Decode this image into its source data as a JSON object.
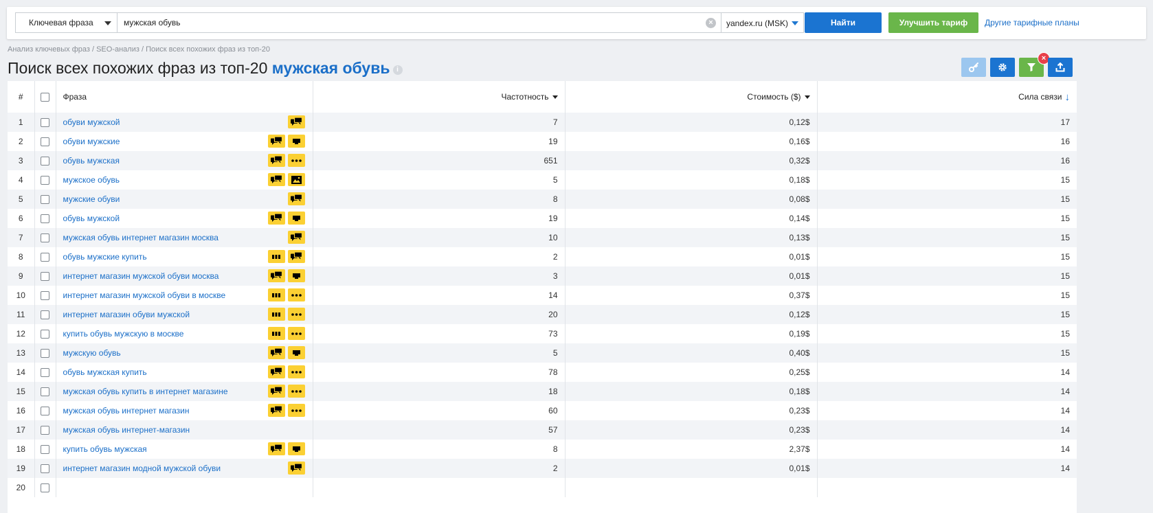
{
  "search": {
    "mode_label": "Ключевая фраза",
    "query": "мужская обувь",
    "region": "yandex.ru (MSK)",
    "find_button": "Найти",
    "upgrade_button": "Улучшить тариф",
    "plans_link": "Другие тарифные планы"
  },
  "breadcrumb": {
    "items": [
      "Анализ ключевых фраз",
      "SEO-анализ",
      "Поиск всех похожих фраз из топ-20"
    ],
    "separator": " / "
  },
  "heading": {
    "title_text": "Поиск всех похожих фраз из топ-20 ",
    "keyword": "мужская обувь"
  },
  "toolbar": {
    "icons": [
      "key-icon",
      "gear-icon",
      "filter-icon",
      "export-icon"
    ],
    "filter_close": "×"
  },
  "colors": {
    "blue": "#1b74d1",
    "green": "#6ab64a",
    "badge_yellow": "#fbd033",
    "link_blue": "#1b6fc8"
  },
  "table": {
    "columns": {
      "num": "#",
      "phrase": "Фраза",
      "frequency": "Частотность",
      "cost": "Стоимость ($)",
      "strength": "Сила связи"
    },
    "rows": [
      {
        "n": "1",
        "phrase": "обуви мужской",
        "badges": [
          "chat"
        ],
        "freq": "7",
        "cost": "0,12$",
        "strength": "17"
      },
      {
        "n": "2",
        "phrase": "обуви мужские",
        "badges": [
          "chat",
          "ad"
        ],
        "freq": "19",
        "cost": "0,16$",
        "strength": "16"
      },
      {
        "n": "3",
        "phrase": "обувь мужская",
        "badges": [
          "chat",
          "dots"
        ],
        "freq": "651",
        "cost": "0,32$",
        "strength": "16"
      },
      {
        "n": "4",
        "phrase": "мужское обувь",
        "badges": [
          "chat",
          "image"
        ],
        "freq": "5",
        "cost": "0,18$",
        "strength": "15"
      },
      {
        "n": "5",
        "phrase": "мужские обуви",
        "badges": [
          "chat"
        ],
        "freq": "8",
        "cost": "0,08$",
        "strength": "15"
      },
      {
        "n": "6",
        "phrase": "обувь мужской",
        "badges": [
          "chat",
          "ad"
        ],
        "freq": "19",
        "cost": "0,14$",
        "strength": "15"
      },
      {
        "n": "7",
        "phrase": "мужская обувь интернет магазин москва",
        "badges": [
          "chat"
        ],
        "freq": "10",
        "cost": "0,13$",
        "strength": "15"
      },
      {
        "n": "8",
        "phrase": "обувь мужские купить",
        "badges": [
          "bars",
          "chat"
        ],
        "freq": "2",
        "cost": "0,01$",
        "strength": "15"
      },
      {
        "n": "9",
        "phrase": "интернет магазин мужской обуви москва",
        "badges": [
          "chat",
          "ad"
        ],
        "freq": "3",
        "cost": "0,01$",
        "strength": "15"
      },
      {
        "n": "10",
        "phrase": "интернет магазин мужской обуви в москве",
        "badges": [
          "bars",
          "dots"
        ],
        "freq": "14",
        "cost": "0,37$",
        "strength": "15"
      },
      {
        "n": "11",
        "phrase": "интернет магазин обуви мужской",
        "badges": [
          "bars",
          "dots"
        ],
        "freq": "20",
        "cost": "0,12$",
        "strength": "15"
      },
      {
        "n": "12",
        "phrase": "купить обувь мужскую в москве",
        "badges": [
          "bars",
          "dots"
        ],
        "freq": "73",
        "cost": "0,19$",
        "strength": "15"
      },
      {
        "n": "13",
        "phrase": "мужскую обувь",
        "badges": [
          "chat",
          "ad"
        ],
        "freq": "5",
        "cost": "0,40$",
        "strength": "15"
      },
      {
        "n": "14",
        "phrase": "обувь мужская купить",
        "badges": [
          "chat",
          "dots"
        ],
        "freq": "78",
        "cost": "0,25$",
        "strength": "14"
      },
      {
        "n": "15",
        "phrase": "мужская обувь купить в интернет магазине",
        "badges": [
          "chat",
          "dots"
        ],
        "freq": "18",
        "cost": "0,18$",
        "strength": "14"
      },
      {
        "n": "16",
        "phrase": "мужская обувь интернет магазин",
        "badges": [
          "chat",
          "dots"
        ],
        "freq": "60",
        "cost": "0,23$",
        "strength": "14"
      },
      {
        "n": "17",
        "phrase": "мужская обувь интернет-магазин",
        "badges": [],
        "freq": "57",
        "cost": "0,23$",
        "strength": "14"
      },
      {
        "n": "18",
        "phrase": "купить обувь мужская",
        "badges": [
          "chat",
          "ad"
        ],
        "freq": "8",
        "cost": "2,37$",
        "strength": "14"
      },
      {
        "n": "19",
        "phrase": "интернет магазин модной мужской обуви",
        "badges": [
          "chat"
        ],
        "freq": "2",
        "cost": "0,01$",
        "strength": "14"
      },
      {
        "n": "20",
        "phrase": "",
        "badges": [],
        "freq": "",
        "cost": "",
        "strength": ""
      }
    ]
  }
}
